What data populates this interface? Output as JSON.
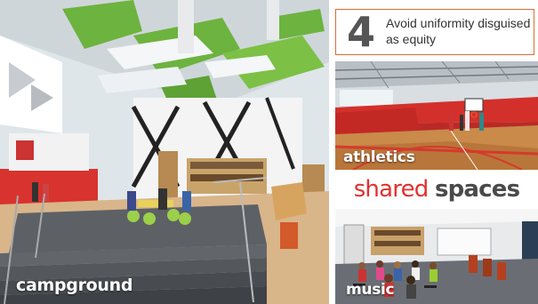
{
  "tip": {
    "number": "4",
    "text": "Avoid uniformity disguised as equity"
  },
  "panels": {
    "campground": {
      "caption": "campground"
    },
    "athletics": {
      "caption": "athletics"
    },
    "music": {
      "caption": "music"
    }
  },
  "heading": {
    "word1": "shared",
    "word2": "spaces"
  },
  "colors": {
    "accent_red": "#e0322e",
    "accent_orange_border": "#e06a3a",
    "green_ceiling": "#6db33f",
    "gym_floor": "#c98a4a",
    "dark_text": "#4a4a4a"
  }
}
